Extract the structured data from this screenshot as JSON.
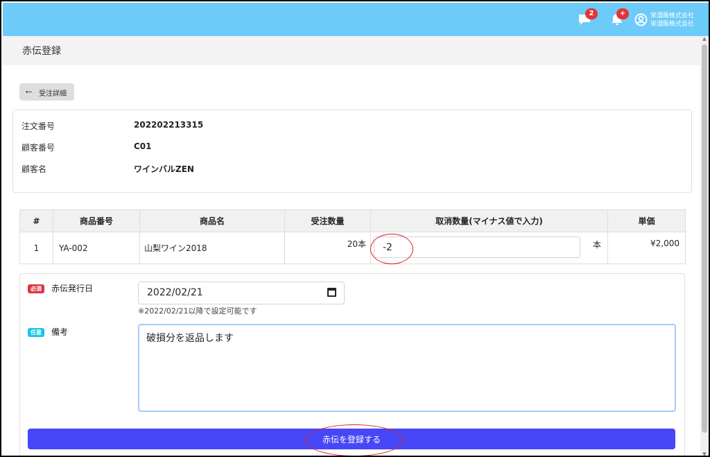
{
  "header": {
    "message_badge": "2",
    "notification_badge": "+",
    "company_line1": "栄酒販株式会社",
    "company_line2": "栄酒販株式会社"
  },
  "page": {
    "title": "赤伝登録"
  },
  "back_button": {
    "label": "受注詳細"
  },
  "order_info": {
    "rows": [
      {
        "label": "注文番号",
        "value": "202202213315"
      },
      {
        "label": "顧客番号",
        "value": "C01"
      },
      {
        "label": "顧客名",
        "value": "ワインバルZEN"
      }
    ]
  },
  "items_table": {
    "headers": [
      "#",
      "商品番号",
      "商品名",
      "受注数量",
      "取消数量(マイナス値で入力)",
      "単価"
    ],
    "rows": [
      {
        "no": "1",
        "code": "YA-002",
        "name": "山梨ワイン2018",
        "ordered_qty": "20本",
        "cancel_qty": "-2",
        "unit": "本",
        "price": "¥2,000"
      }
    ]
  },
  "form": {
    "issue_date": {
      "badge": "必須",
      "label": "赤伝発行日",
      "value": "2022/02/21",
      "hint": "※2022/02/21以降で設定可能です"
    },
    "remarks": {
      "badge": "任意",
      "label": "備考",
      "value": "破損分を返品します"
    },
    "submit_label": "赤伝を登録する"
  },
  "colors": {
    "topbar": "#6ccbf9",
    "required_badge": "#dc3545",
    "optional_badge": "#17c6e6",
    "submit_button": "#4747f7",
    "annotation_circle": "#e02020"
  }
}
